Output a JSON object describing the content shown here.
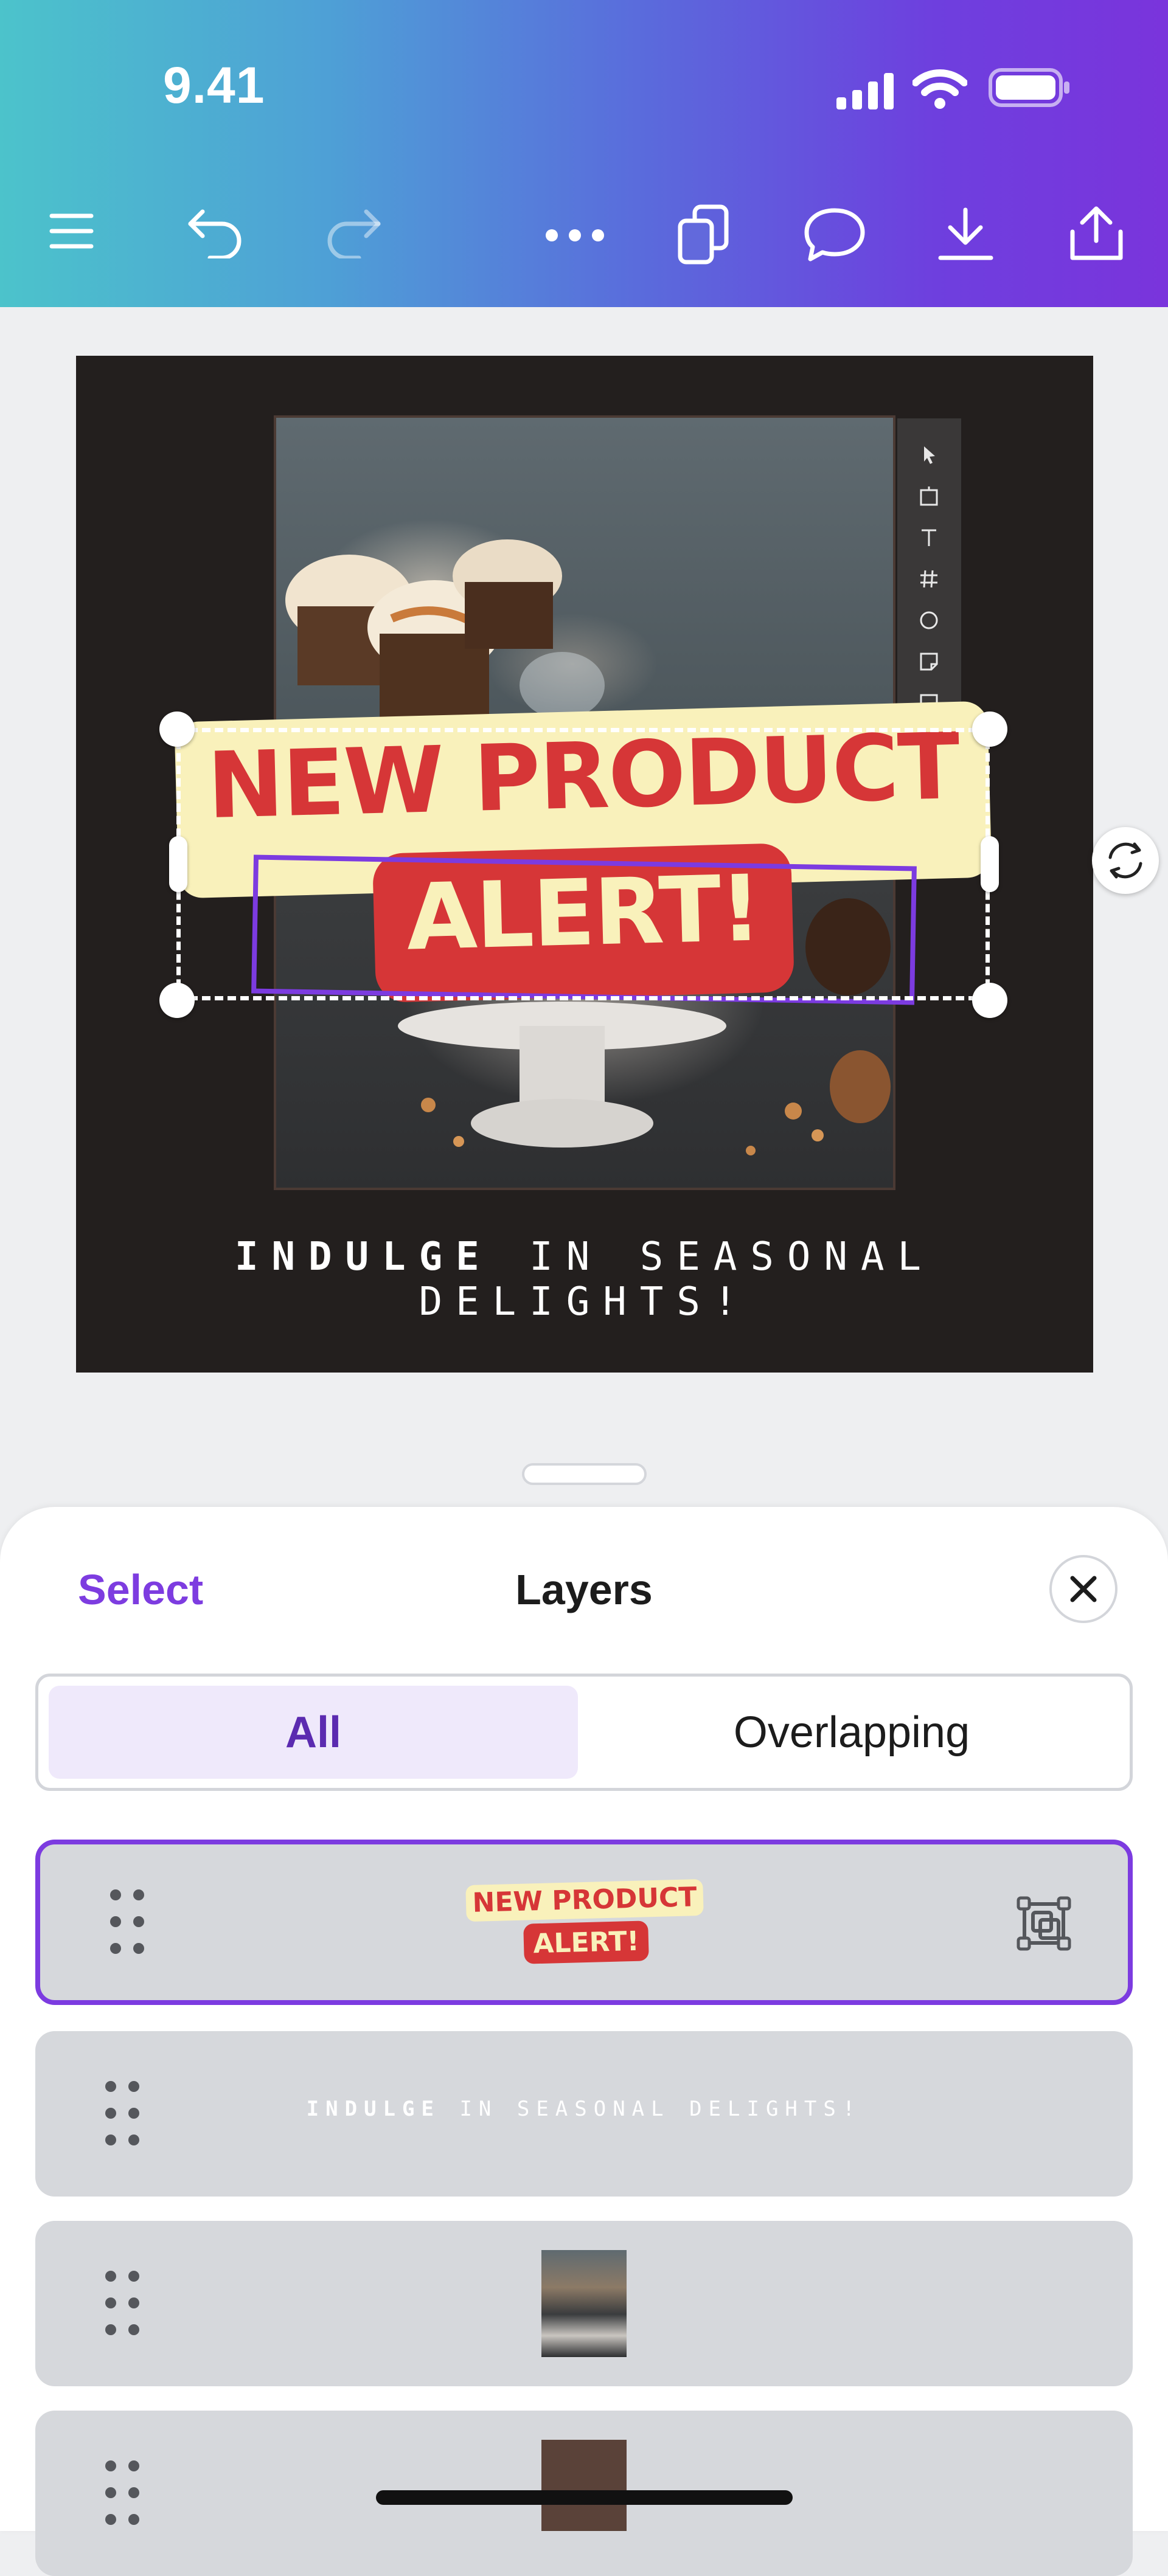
{
  "status_bar": {
    "time": "9.41",
    "icons": [
      "signal-icon",
      "wifi-icon",
      "battery-icon"
    ]
  },
  "toolbar": {
    "icons": [
      "menu-icon",
      "undo-icon",
      "redo-icon",
      "more-icon",
      "duplicate-icon",
      "comment-icon",
      "download-icon",
      "share-icon"
    ],
    "redo_enabled": false
  },
  "design": {
    "headline": "NEW PRODUCT",
    "alert": "ALERT!",
    "tagline_bold": "INDULGE",
    "tagline_rest": " IN SEASONAL DELIGHTS!",
    "mini_toolbar_icons": [
      "pointer-icon",
      "frame-icon",
      "text-icon",
      "hash-icon",
      "circle-icon",
      "sticky-icon",
      "image-icon"
    ]
  },
  "layers_panel": {
    "select_label": "Select",
    "title": "Layers",
    "tabs": [
      {
        "label": "All",
        "active": true
      },
      {
        "label": "Overlapping",
        "active": false
      }
    ],
    "layers": [
      {
        "type": "group",
        "thumb_line1": "NEW PRODUCT",
        "thumb_line2": "ALERT!",
        "selected": true
      },
      {
        "type": "text",
        "thumb_bold": "INDULGE",
        "thumb_rest": " IN SEASONAL DELIGHTS!",
        "selected": false
      },
      {
        "type": "image",
        "selected": false
      },
      {
        "type": "shape",
        "selected": false
      }
    ]
  },
  "colors": {
    "accent": "#7c3be0",
    "headline_red": "#d63637",
    "headline_cream": "#f9f1bb",
    "design_bg": "#231f1e"
  }
}
